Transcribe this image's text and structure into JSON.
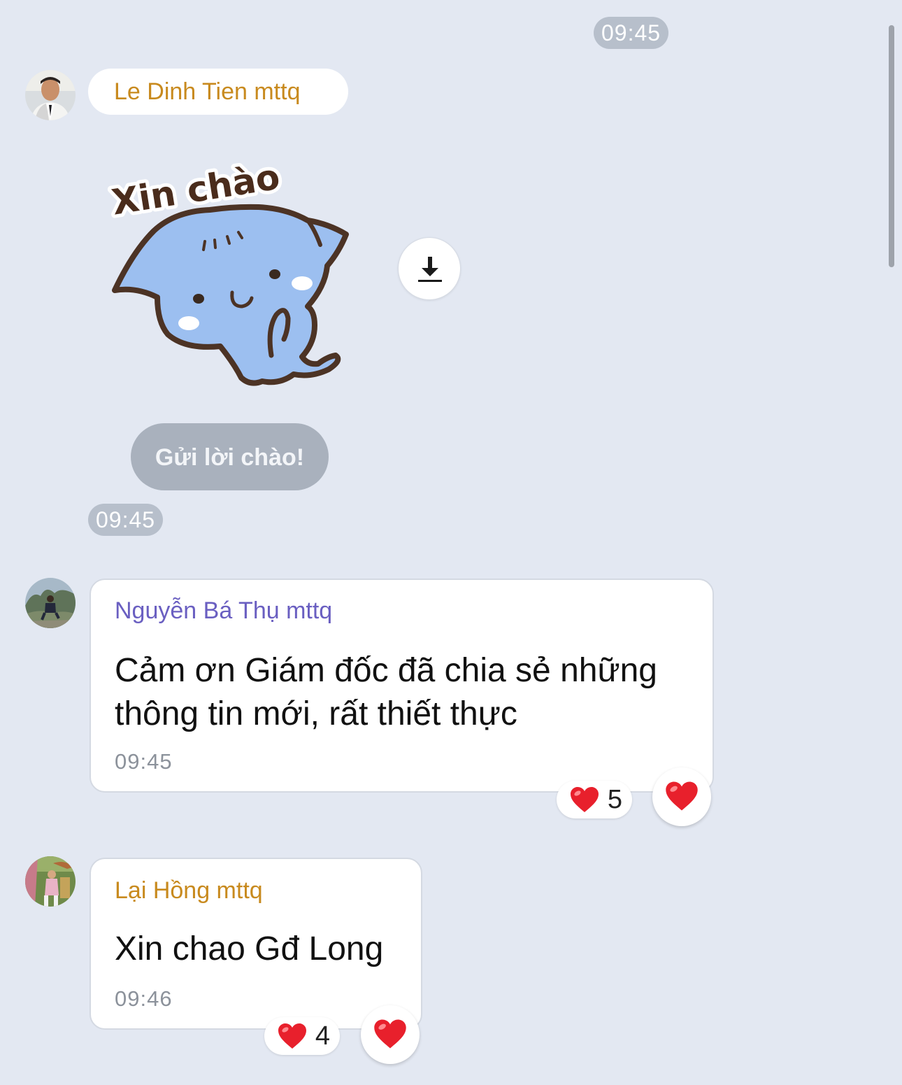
{
  "chat": {
    "top_time": "09:45",
    "messages": [
      {
        "sender": "Le Dinh Tien mttq",
        "sticker_text": "Xin chào",
        "greet_button": "Gửi lời chào!",
        "time": "09:45"
      },
      {
        "sender": "Nguyễn Bá Thụ mttq",
        "text_line1": "Cảm ơn Giám đốc đã chia sẻ những",
        "text_line2": "thông tin mới, rất thiết thực",
        "time": "09:45",
        "reaction_count": "5"
      },
      {
        "sender": "Lại Hồng mttq",
        "text": "Xin chao Gđ Long",
        "time": "09:46",
        "reaction_count": "4"
      }
    ]
  },
  "colors": {
    "background": "#e3e8f2",
    "sender_orange": "#c88a1e",
    "sender_purple": "#6a5fc1",
    "reaction_heart": "#e8202c"
  },
  "icons": {
    "download": "download-arrow-icon",
    "heart": "heart-icon"
  }
}
